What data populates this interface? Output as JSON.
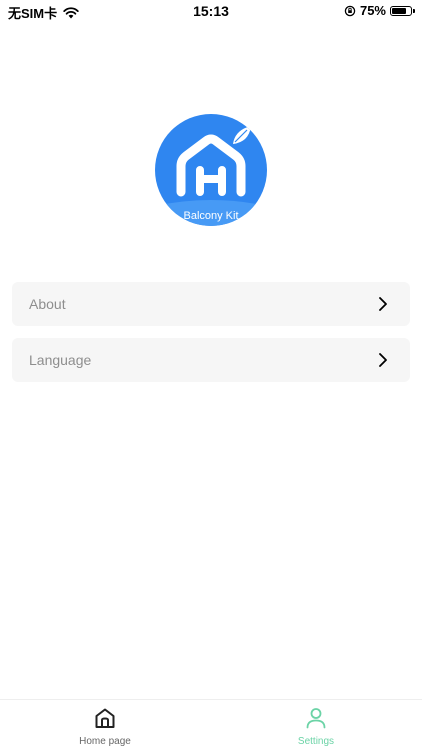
{
  "status_bar": {
    "carrier": "无SIM卡",
    "time": "15:13",
    "battery": "75%",
    "battery_level": 0.75
  },
  "logo": {
    "text": "Balcony Kit",
    "color": "#2f86f0"
  },
  "menu": {
    "items": [
      {
        "label": "About"
      },
      {
        "label": "Language"
      }
    ]
  },
  "tabbar": {
    "tabs": [
      {
        "label": "Home page",
        "icon": "home-icon",
        "active": false
      },
      {
        "label": "Settings",
        "icon": "user-icon",
        "active": true
      }
    ],
    "active_color": "#6bd3a6"
  }
}
